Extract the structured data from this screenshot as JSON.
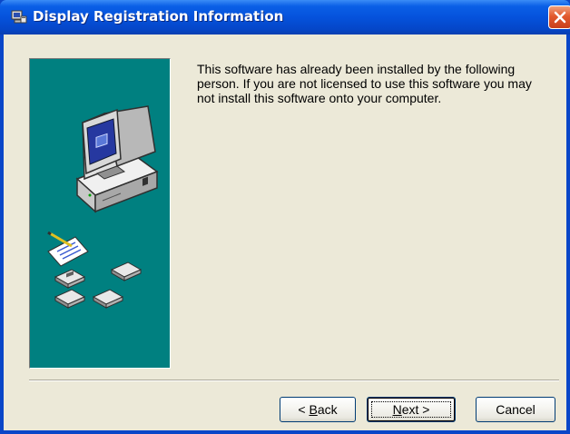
{
  "window": {
    "title": "Display Registration Information",
    "icon": "setup-computer-icon",
    "close_icon": "close-icon"
  },
  "message": {
    "text": "This software has already been installed by the following person. If you are not licensed to use this software you may not install this software onto your computer."
  },
  "side_panel": {
    "image": "computer-with-disks-illustration",
    "background_color": "#008080"
  },
  "buttons": {
    "back_prefix": "< ",
    "back_accel": "B",
    "back_rest": "ack",
    "next_accel": "N",
    "next_rest": "ext >",
    "cancel": "Cancel"
  },
  "colors": {
    "titlebar": "#0552dc",
    "close_button": "#e2592d",
    "dialog_face": "#ece9d8"
  }
}
